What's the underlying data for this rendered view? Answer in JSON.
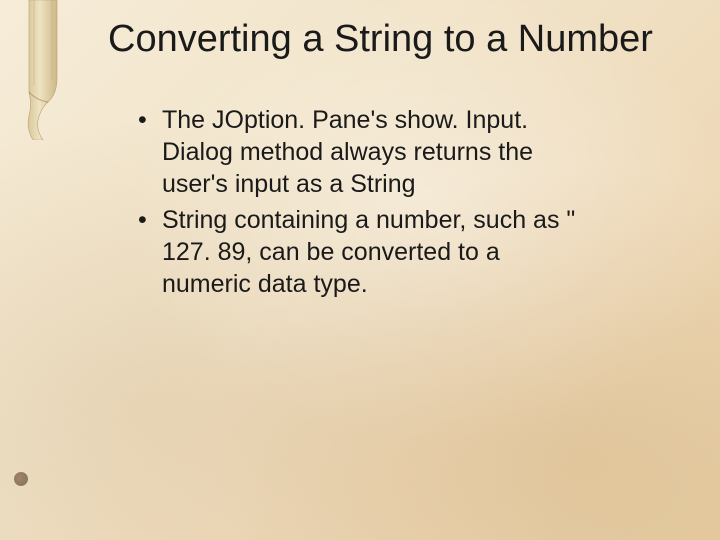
{
  "slide": {
    "title": "Converting a String to a Number",
    "bullets": [
      "The JOption. Pane's show. Input. Dialog method always returns the user's input as a String",
      "String containing a number, such as \" 127. 89, can be converted to a numeric data type."
    ]
  }
}
